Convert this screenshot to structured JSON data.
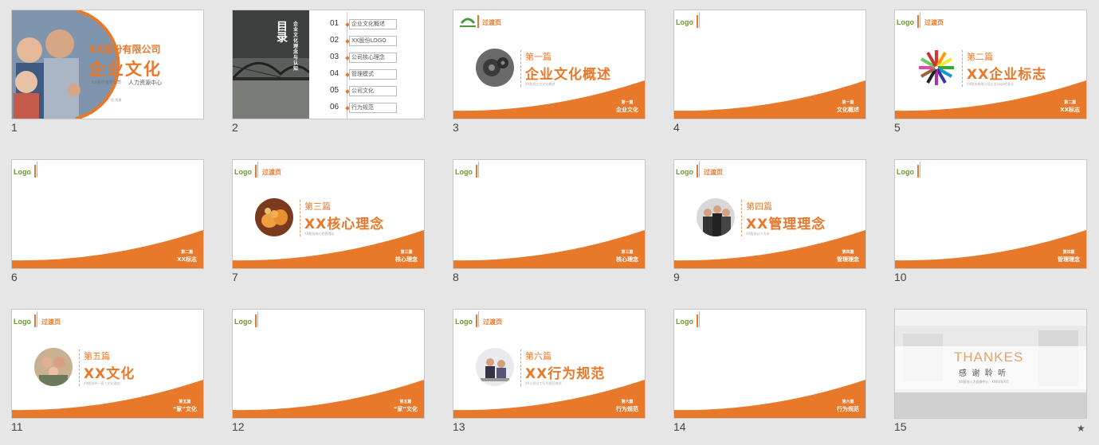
{
  "colors": {
    "accent": "#e8782a",
    "logo": "#6a9a2a",
    "background": "#e6e6e6"
  },
  "slides": [
    {
      "num": "1",
      "company": "XX股份有限公司",
      "title": "企业文化",
      "sub_left": "XX股份有限公司",
      "sub_right": "人力资源中心",
      "sub_small": "广告·资源"
    },
    {
      "num": "2",
      "toc_title": "目录",
      "toc_vertical": "企业文化理念与认知",
      "toc": [
        {
          "n": "01",
          "t": "企业文化概述"
        },
        {
          "n": "02",
          "t": "XX股份LOGO"
        },
        {
          "n": "03",
          "t": "公司核心理念"
        },
        {
          "n": "04",
          "t": "管理模式"
        },
        {
          "n": "05",
          "t": "公司文化"
        },
        {
          "n": "06",
          "t": "行为规范"
        }
      ]
    },
    {
      "num": "3",
      "trans": "过渡页",
      "pian": "第一篇",
      "ptitle": "企业文化概述",
      "psub": "XX股份企业文化概述",
      "f1": "第一篇",
      "f2": "企业文化"
    },
    {
      "num": "4",
      "logo": "Logo",
      "f1": "第一篇",
      "f2": "文化概述"
    },
    {
      "num": "5",
      "logo": "Logo",
      "trans": "过渡页",
      "pian": "第二篇",
      "ptitle": "XX企业标志",
      "psub": "XX股份有限公司企业Logo的意义",
      "f1": "第二篇",
      "f2": "XX标志"
    },
    {
      "num": "6",
      "logo": "Logo",
      "f1": "第二篇",
      "f2": "XX标志"
    },
    {
      "num": "7",
      "logo": "Logo",
      "trans": "过渡页",
      "pian": "第三篇",
      "ptitle": "XX核心理念",
      "psub": "XX股份核心经营理念",
      "f1": "第三篇",
      "f2": "核心理念"
    },
    {
      "num": "8",
      "logo": "Logo",
      "f1": "第三篇",
      "f2": "核心理念"
    },
    {
      "num": "9",
      "logo": "Logo",
      "trans": "过渡页",
      "pian": "第四篇",
      "ptitle": "XX管理理念",
      "psub": "XX股份以人为本",
      "f1": "第四篇",
      "f2": "管理理念"
    },
    {
      "num": "10",
      "logo": "Logo",
      "f1": "第四篇",
      "f2": "管理理念"
    },
    {
      "num": "11",
      "logo": "Logo",
      "trans": "过渡页",
      "pian": "第五篇",
      "ptitle": "XX文化",
      "psub": "XX股份的一家人文化理念",
      "f1": "第五篇",
      "f2": "“家”文化"
    },
    {
      "num": "12",
      "logo": "Logo",
      "f1": "第五篇",
      "f2": "“家”文化"
    },
    {
      "num": "13",
      "logo": "Logo",
      "trans": "过渡页",
      "pian": "第六篇",
      "ptitle": "XX行为规范",
      "psub": "XX公司员工行为规范准则",
      "f1": "第六篇",
      "f2": "行为规范"
    },
    {
      "num": "14",
      "logo": "Logo",
      "f1": "第六篇",
      "f2": "行为规范"
    },
    {
      "num": "15",
      "thanks": "THANKES",
      "thanks_cn": "感  谢  聆  听",
      "thanks_sub": "XX股份人力资源中心 · XXXX年X月"
    }
  ],
  "star": "★"
}
